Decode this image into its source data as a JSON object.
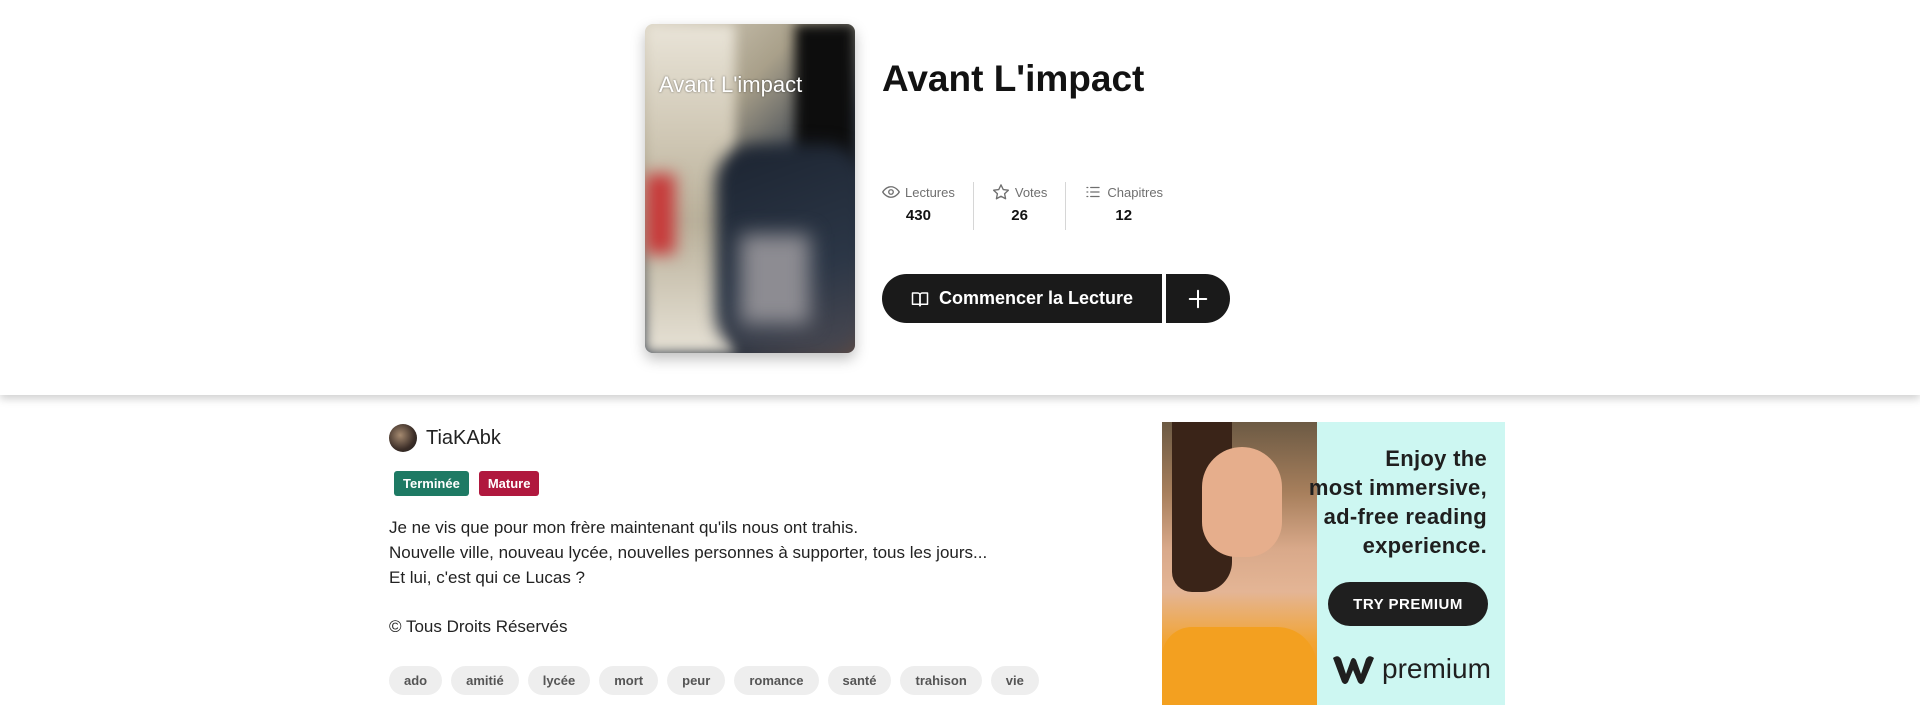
{
  "story": {
    "cover_text": "Avant L'impact",
    "title": "Avant L'impact"
  },
  "stats": [
    {
      "label": "Lectures",
      "value": "430",
      "icon": "eye-icon"
    },
    {
      "label": "Votes",
      "value": "26",
      "icon": "star-icon"
    },
    {
      "label": "Chapitres",
      "value": "12",
      "icon": "list-icon"
    }
  ],
  "actions": {
    "read_label": "Commencer la Lecture",
    "add_icon": "plus-icon"
  },
  "author": {
    "name": "TiaKAbk"
  },
  "badges": [
    {
      "label": "Terminée",
      "color": "#1e7a64"
    },
    {
      "label": "Mature",
      "color": "#b0183e"
    }
  ],
  "description": [
    "Je ne vis que pour mon frère maintenant qu'ils nous ont trahis.",
    "Nouvelle ville, nouveau lycée, nouvelles personnes à supporter, tous les jours...",
    "Et lui, c'est qui ce Lucas ?"
  ],
  "copyright": "© Tous Droits Réservés",
  "tags": [
    "ado",
    "amitié",
    "lycée",
    "mort",
    "peur",
    "romance",
    "santé",
    "trahison",
    "vie"
  ],
  "ad": {
    "headline": [
      "Enjoy the",
      "most immersive,",
      "ad-free reading",
      "experience."
    ],
    "button": "TRY PREMIUM",
    "logo_text": "premium",
    "background": "#cdf7f2"
  }
}
